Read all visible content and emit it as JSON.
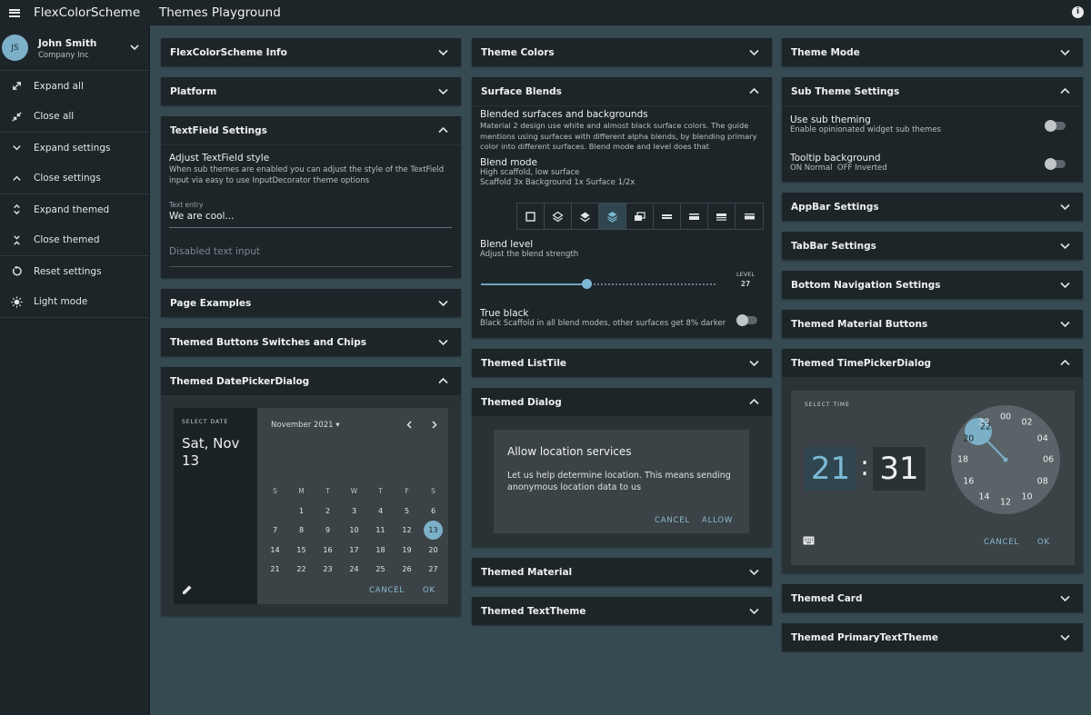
{
  "app": {
    "name": "FlexColorScheme",
    "page": "Themes Playground",
    "info_icon": "info-icon"
  },
  "user": {
    "initials": "JS",
    "name": "John Smith",
    "company": "Company Inc"
  },
  "drawer": [
    {
      "label": "Expand all",
      "icon": "expand-arrows-icon"
    },
    {
      "label": "Close all",
      "icon": "collapse-arrows-icon"
    },
    {
      "label": "Expand settings",
      "icon": "chevron-down-icon"
    },
    {
      "label": "Close settings",
      "icon": "chevron-up-icon"
    },
    {
      "label": "Expand themed",
      "icon": "unfold-more-icon"
    },
    {
      "label": "Close themed",
      "icon": "unfold-less-icon"
    },
    {
      "label": "Reset settings",
      "icon": "reset-icon"
    },
    {
      "label": "Light mode",
      "icon": "sun-icon"
    }
  ],
  "col1": {
    "info": "FlexColorScheme Info",
    "platform": "Platform",
    "textfield": {
      "title": "TextField Settings",
      "heading": "Adjust TextField style",
      "desc": "When sub themes are enabled you can adjust the style of the TextField input via easy to use InputDecorator theme options",
      "entry_label": "Text entry",
      "entry_value": "We are cool...",
      "disabled_placeholder": "Disabled text input"
    },
    "page_examples": "Page Examples",
    "buttons": "Themed Buttons Switches and Chips",
    "datepicker": {
      "title": "Themed DatePickerDialog",
      "select_label": "SELECT DATE",
      "date": "Sat, Nov 13",
      "month": "November 2021",
      "weekdays": [
        "S",
        "M",
        "T",
        "W",
        "T",
        "F",
        "S"
      ],
      "days": [
        "",
        "1",
        "2",
        "3",
        "4",
        "5",
        "6",
        "7",
        "8",
        "9",
        "10",
        "11",
        "12",
        "13",
        "14",
        "15",
        "16",
        "17",
        "18",
        "19",
        "20",
        "21",
        "22",
        "23",
        "24",
        "25",
        "26",
        "27"
      ],
      "selected_day": "13",
      "cancel": "CANCEL",
      "ok": "OK"
    }
  },
  "col2": {
    "theme_colors": "Theme Colors",
    "surface": {
      "title": "Surface Blends",
      "heading": "Blended surfaces and backgrounds",
      "desc": "Material 2 design use white and almost black surface colors. The guide mentions using surfaces with different alpha blends, by blending primary color into different surfaces. Blend mode and level does that",
      "mode_heading": "Blend mode",
      "mode_line1": "High scaffold, low surface",
      "mode_line2": "Scaffold 3x  Background 1x  Surface 1/2x",
      "level_heading": "Blend level",
      "level_desc": "Adjust the blend strength",
      "level_label": "LEVEL",
      "level_value": "27",
      "level_fraction": 0.45,
      "true_black_heading": "True black",
      "true_black_desc": "Black Scaffold in all blend modes, other surfaces get 8% darker"
    },
    "listtile": "Themed ListTile",
    "dialog": {
      "title": "Themed Dialog",
      "heading": "Allow location services",
      "body": "Let us help determine location. This means sending anonymous location data to us",
      "cancel": "CANCEL",
      "allow": "ALLOW"
    },
    "material": "Themed Material",
    "texttheme": "Themed TextTheme"
  },
  "col3": {
    "theme_mode": "Theme Mode",
    "subtheme": {
      "title": "Sub Theme Settings",
      "use_heading": "Use sub theming",
      "use_desc": "Enable opinionated widget sub themes",
      "tooltip_heading": "Tooltip background",
      "tooltip_desc": "ON Normal  OFF Inverted"
    },
    "appbar": "AppBar Settings",
    "tabbar": "TabBar Settings",
    "bottomnav": "Bottom Navigation Settings",
    "material_buttons": "Themed Material Buttons",
    "timepicker": {
      "title": "Themed TimePickerDialog",
      "select_label": "SELECT TIME",
      "hour": "21",
      "colon": ":",
      "minute": "31",
      "outer": [
        "00",
        "02",
        "04",
        "06",
        "08",
        "10",
        "12",
        "14",
        "16",
        "18",
        "20",
        "22"
      ],
      "inner_selected": "22",
      "cancel": "CANCEL",
      "ok": "OK"
    },
    "card": "Themed Card",
    "primary_text": "Themed PrimaryTextTheme"
  }
}
